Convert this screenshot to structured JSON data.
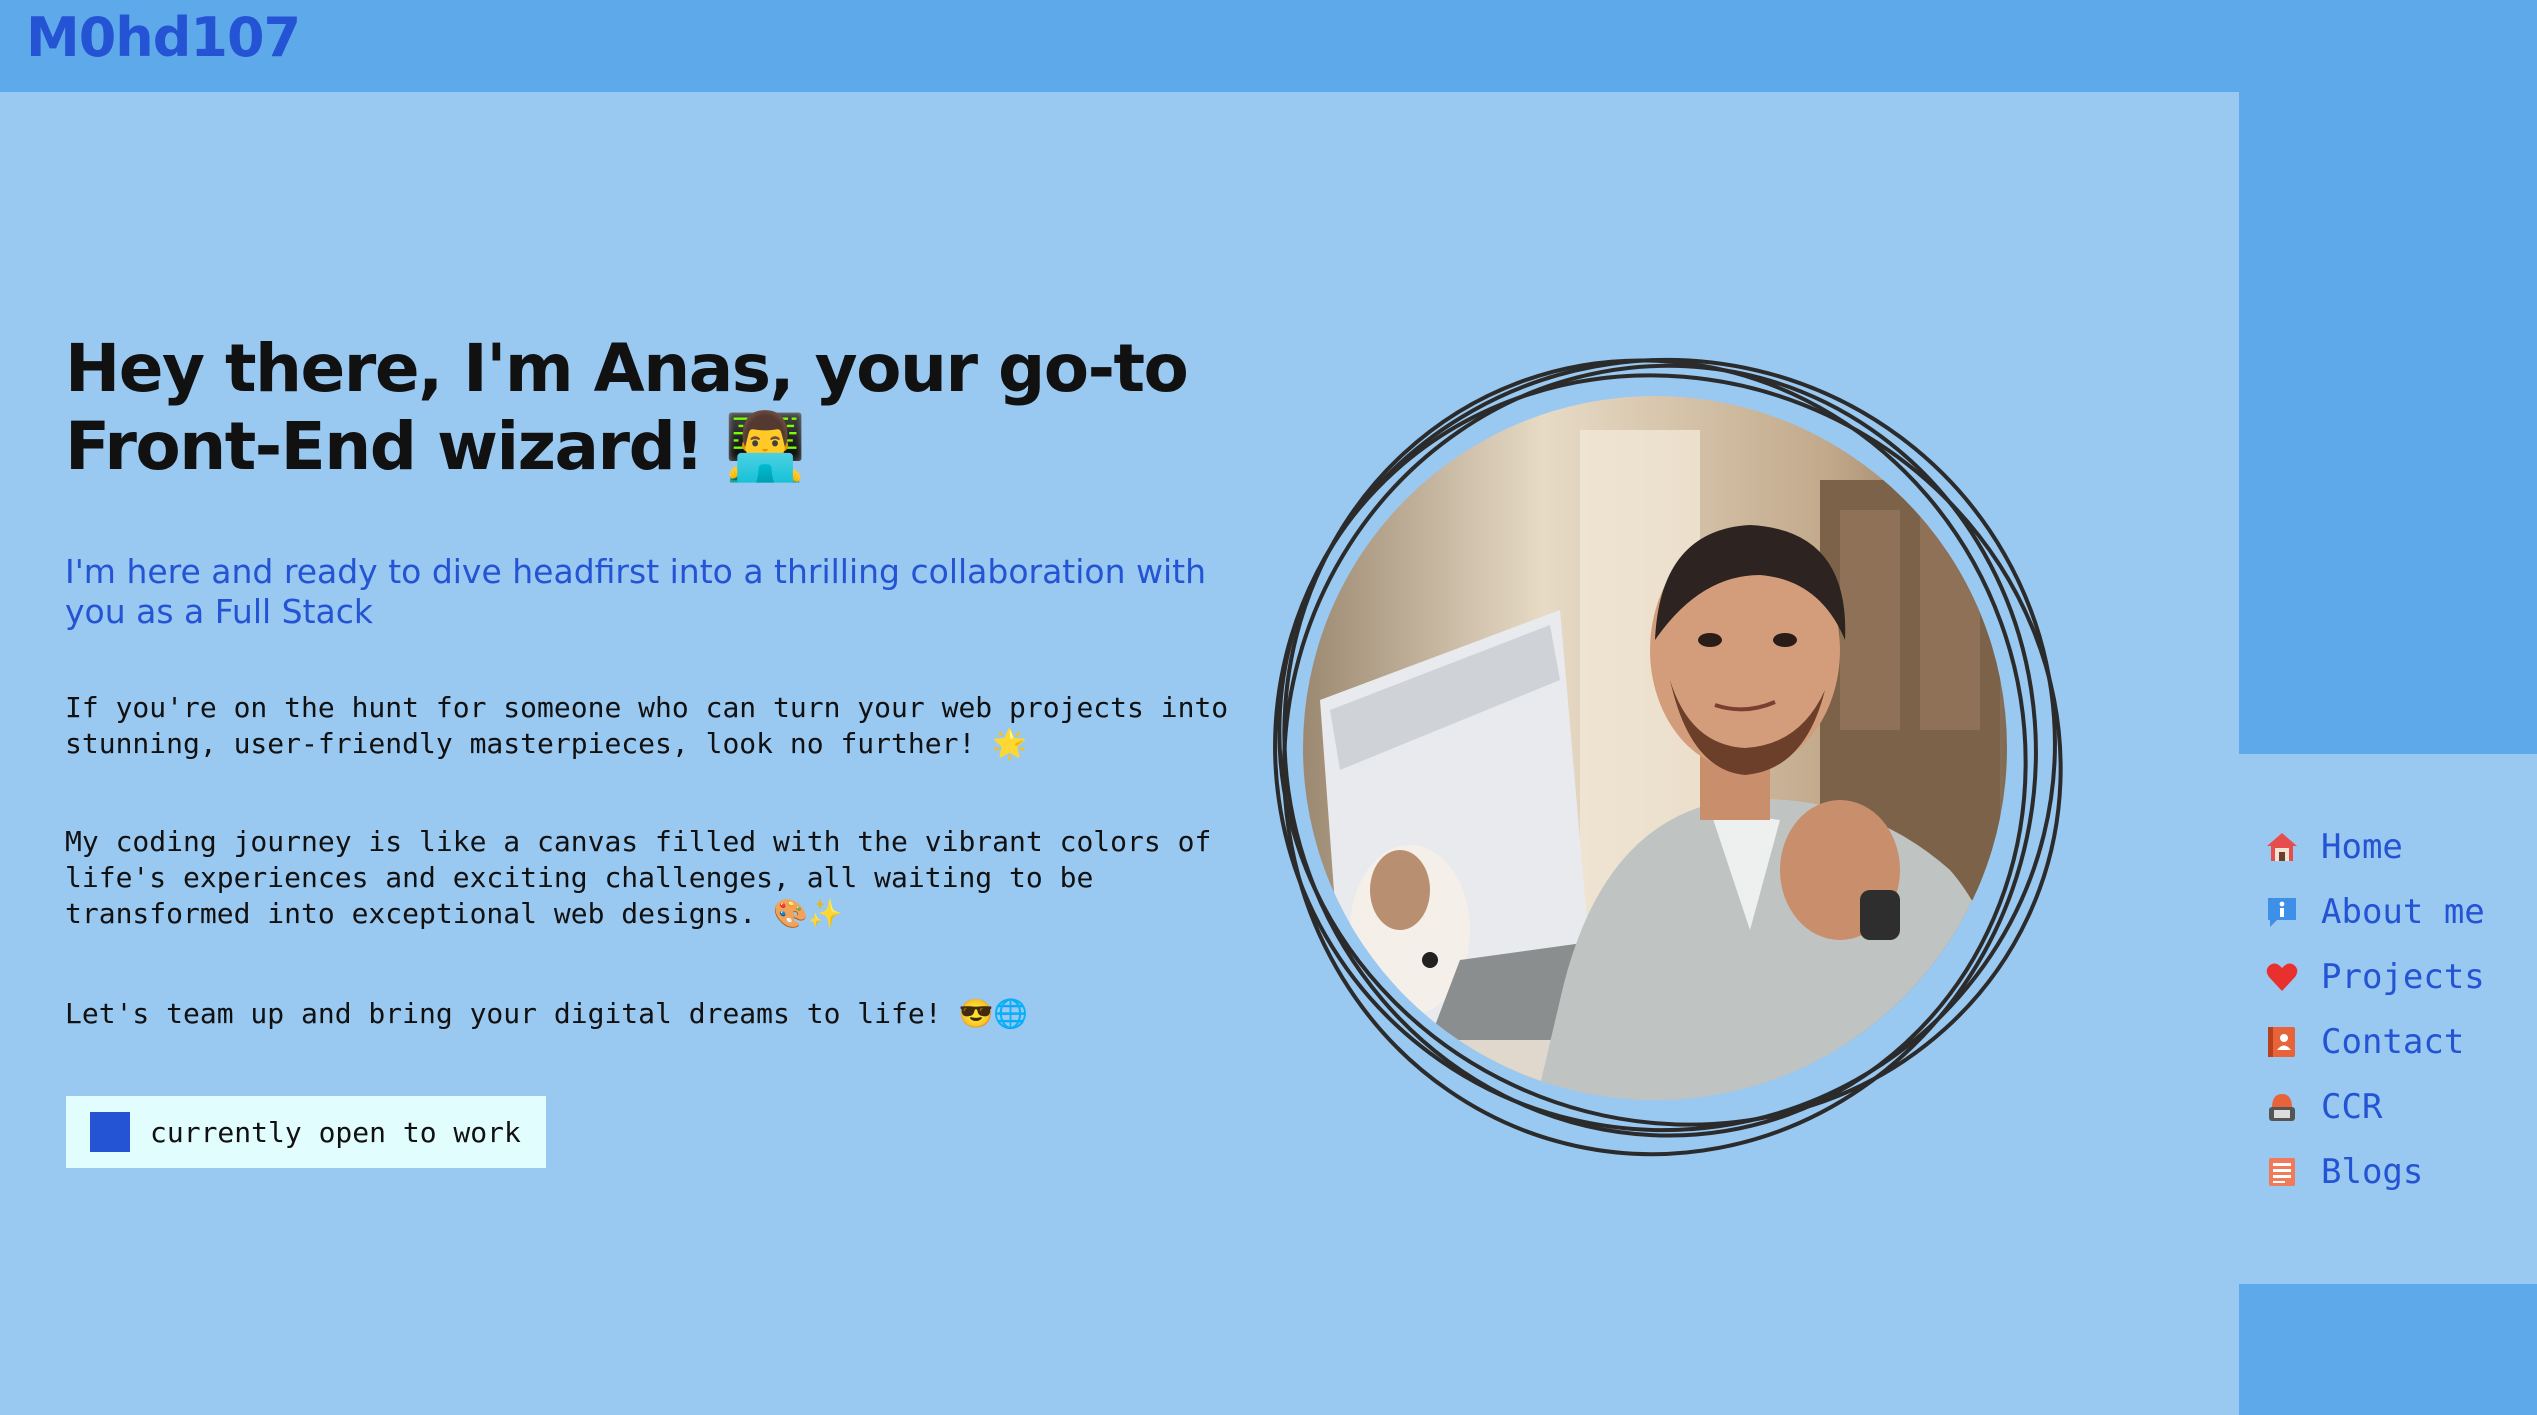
{
  "site": {
    "logo": "M0hd107"
  },
  "hero": {
    "headline": "Hey there, I'm Anas, your go-to Front-End wizard! 👨‍💻",
    "subhead": "I'm here and ready to dive headfirst into a thrilling collaboration with you as a Full Stack",
    "paragraphs": [
      "If you're on the hunt for someone who can turn your web projects into stunning, user-friendly masterpieces, look no further! 🌟",
      "My coding journey is like a canvas filled with the vibrant colors of life's experiences and exciting challenges, all waiting to be transformed into exceptional web designs. 🎨✨",
      "Let's team up and bring your digital dreams to life! 😎🌐"
    ],
    "status": "currently open to work",
    "portrait_icon": "portrait-illustration"
  },
  "nav": {
    "items": [
      {
        "label": "Home",
        "icon": "home-icon"
      },
      {
        "label": "About me",
        "icon": "info-icon"
      },
      {
        "label": "Projects",
        "icon": "heart-icon"
      },
      {
        "label": "Contact",
        "icon": "contact-book-icon"
      },
      {
        "label": "CCR",
        "icon": "ccr-icon"
      },
      {
        "label": "Blogs",
        "icon": "blog-icon"
      }
    ]
  },
  "colors": {
    "header_bg": "#5ea9ea",
    "main_bg": "#99c8f1",
    "accent": "#2453d4",
    "badge_bg": "#e2fdfd"
  }
}
